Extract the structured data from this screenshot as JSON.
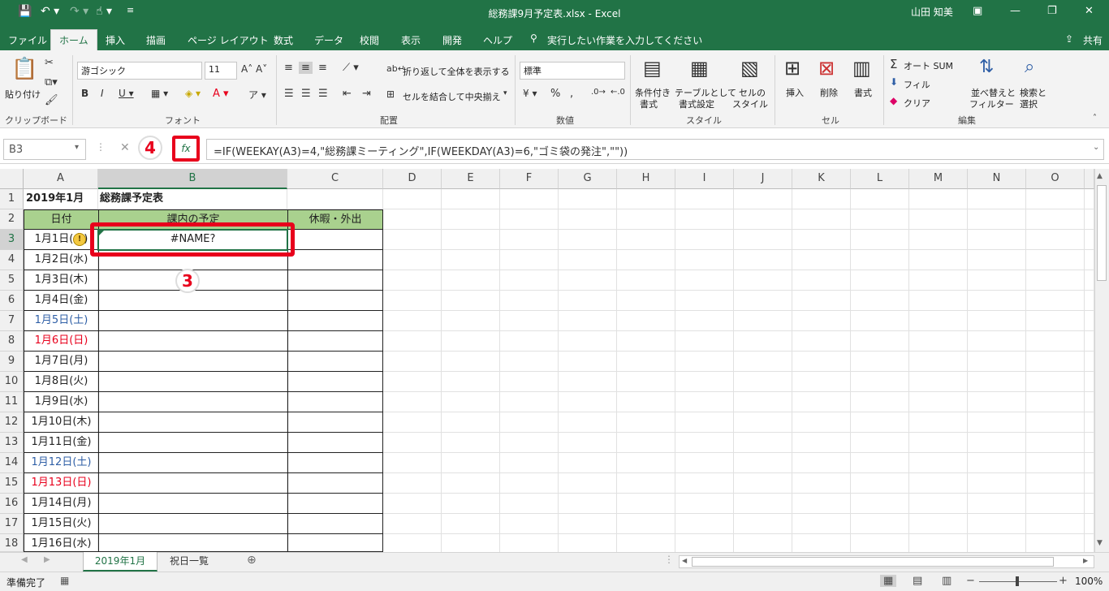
{
  "title_bar": {
    "file_title": "総務課9月予定表.xlsx  -  Excel",
    "user": "山田 知美"
  },
  "tabs": [
    "ファイル",
    "ホーム",
    "挿入",
    "描画",
    "ページ レイアウト",
    "数式",
    "データ",
    "校閲",
    "表示",
    "開発",
    "ヘルプ"
  ],
  "tell_me": "実行したい作業を入力してください",
  "share": "共有",
  "ribbon": {
    "clipboard": {
      "paste": "貼り付け",
      "group": "クリップボード"
    },
    "font": {
      "name": "游ゴシック",
      "size": "11",
      "group": "フォント"
    },
    "alignment": {
      "wrap": "折り返して全体を表示する",
      "merge": "セルを結合して中央揃え",
      "group": "配置"
    },
    "number": {
      "format": "標準",
      "group": "数値"
    },
    "styles": {
      "conditional": "条件付き",
      "conditional2": "書式",
      "table": "テーブルとして",
      "table2": "書式設定",
      "cell": "セルの",
      "cell2": "スタイル",
      "group": "スタイル"
    },
    "cells": {
      "insert": "挿入",
      "delete": "削除",
      "format": "書式",
      "group": "セル"
    },
    "editing": {
      "autosum": "オート SUM",
      "fill": "フィル",
      "clear": "クリア",
      "sort": "並べ替えと",
      "sort2": "フィルター",
      "find": "検索と",
      "find2": "選択",
      "group": "編集"
    }
  },
  "formula_bar": {
    "name_box": "B3",
    "fx": "fx",
    "formula": "=IF(WEEKAY(A3)=4,\"総務課ミーティング\",IF(WEEKDAY(A3)=6,\"ゴミ袋の発注\",\"\"))"
  },
  "annotations": {
    "step3": "3",
    "step4": "4"
  },
  "columns": [
    "A",
    "B",
    "C",
    "D",
    "E",
    "F",
    "G",
    "H",
    "I",
    "J",
    "K",
    "L",
    "M",
    "N",
    "O"
  ],
  "rows": [
    "1",
    "2",
    "3",
    "4",
    "5",
    "6",
    "7",
    "8",
    "9",
    "10",
    "11",
    "12",
    "13",
    "14",
    "15",
    "16",
    "17",
    "18"
  ],
  "sheet": {
    "title_a1": "2019年1月",
    "title_b1": "総務課予定表",
    "header_date": "日付",
    "header_plan": "課内の予定",
    "header_leave": "休暇・外出",
    "b3_value": "#NAME?",
    "dates": [
      {
        "text": "1月1日(火)",
        "color": "#222222"
      },
      {
        "text": "1月2日(水)",
        "color": "#222222"
      },
      {
        "text": "1月3日(木)",
        "color": "#222222"
      },
      {
        "text": "1月4日(金)",
        "color": "#222222"
      },
      {
        "text": "1月5日(土)",
        "color": "#2f5fa6"
      },
      {
        "text": "1月6日(日)",
        "color": "#e8001c"
      },
      {
        "text": "1月7日(月)",
        "color": "#222222"
      },
      {
        "text": "1月8日(火)",
        "color": "#222222"
      },
      {
        "text": "1月9日(水)",
        "color": "#222222"
      },
      {
        "text": "1月10日(木)",
        "color": "#222222"
      },
      {
        "text": "1月11日(金)",
        "color": "#222222"
      },
      {
        "text": "1月12日(土)",
        "color": "#2f5fa6"
      },
      {
        "text": "1月13日(日)",
        "color": "#e8001c"
      },
      {
        "text": "1月14日(月)",
        "color": "#222222"
      },
      {
        "text": "1月15日(火)",
        "color": "#222222"
      },
      {
        "text": "1月16日(水)",
        "color": "#222222"
      }
    ]
  },
  "sheet_tabs": [
    "2019年1月",
    "祝日一覧"
  ],
  "status": {
    "ready": "準備完了",
    "zoom": "100%"
  },
  "colors": {
    "excel_green": "#217346",
    "header_green": "#a9d18e",
    "highlight_red": "#e8001c"
  }
}
